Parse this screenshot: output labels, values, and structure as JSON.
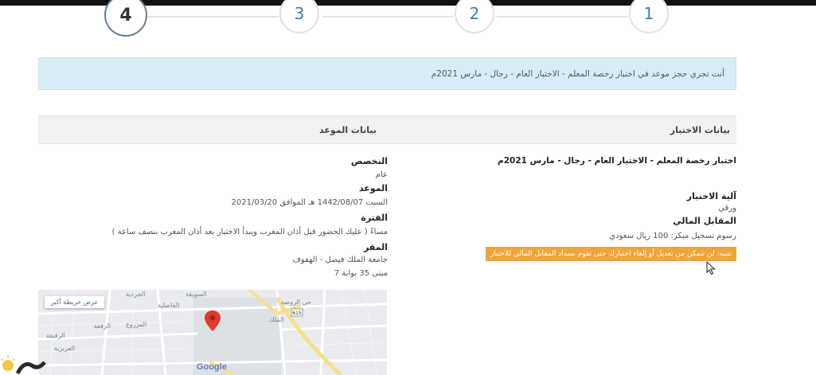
{
  "steps": [
    {
      "number": "4",
      "active": true
    },
    {
      "number": "3",
      "active": false
    },
    {
      "number": "2",
      "active": false
    },
    {
      "number": "1",
      "active": false
    }
  ],
  "banner": {
    "text": "أنت تجري حجز موعد في اختبار رخصة المعلم - الاختبار العام - رجال - مارس 2021م"
  },
  "exam_panel": {
    "header": "بيانات الاختبار",
    "exam_name": "اختبار رخصة المعلم - الاختبار العام - رجال - مارس 2021م",
    "mechanism_label": "آلية الاختبار",
    "mechanism_value": "ورقي",
    "fee_label": "المقابل المالي",
    "fee_value": "رسوم تسجيل مبكر: 100 ريال سعودي",
    "warning": "تنبيه: لن تتمكن من تعديل أو إلغاء اختبارك حتى تقوم بسداد المقابل المالي للاختبار"
  },
  "appointment_panel": {
    "header": "بيانات الموعد",
    "specialty_label": "التخصص",
    "specialty_value": "عام",
    "date_label": "الموعد",
    "date_value": "السبت 1442/08/07 هـ الموافق 2021/03/20",
    "period_label": "الفترة",
    "period_value": "مساءً ( عليك الحضور قبل أذان المغرب ويبدأ الاختبار بعد أذان المغرب بنصف ساعة )",
    "location_label": "المقر",
    "location_value": "جامعة الملك فيصل - الهفوف",
    "building_value": "مبنى 35 بوابة 7"
  },
  "map": {
    "view_larger": "عرض خريطة أكبر",
    "google": "Google",
    "labels": [
      "الجردية",
      "الفاضلية",
      "السويقة",
      "حي الروضة",
      "الرفعة",
      "المزروع",
      "العزيزية",
      "الملك",
      "615",
      "الرقيقة"
    ]
  },
  "colors": {
    "banner_bg": "#d9ecf6",
    "warning_bg": "#f0a43c",
    "step_text": "#3f7fb0"
  }
}
